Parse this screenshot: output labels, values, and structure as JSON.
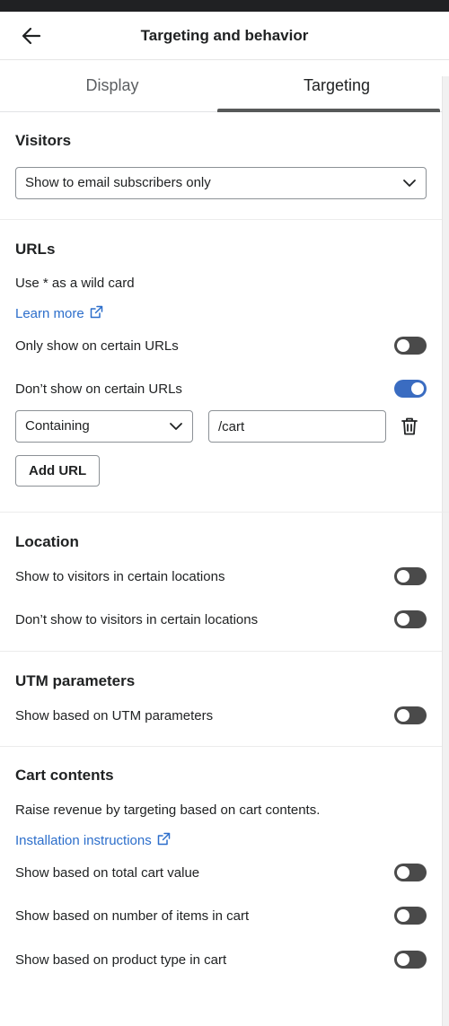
{
  "header": {
    "title": "Targeting and behavior"
  },
  "tabs": [
    {
      "label": "Display",
      "active": false
    },
    {
      "label": "Targeting",
      "active": true
    }
  ],
  "visitors": {
    "heading": "Visitors",
    "selected": "Show to email subscribers only"
  },
  "urls": {
    "heading": "URLs",
    "hint": "Use * as a wild card",
    "learn_more": "Learn more",
    "only_show": {
      "label": "Only show on certain URLs",
      "on": false
    },
    "dont_show": {
      "label": "Don’t show on certain URLs",
      "on": true
    },
    "rule": {
      "match": "Containing",
      "value": "/cart"
    },
    "add_label": "Add URL"
  },
  "location": {
    "heading": "Location",
    "show": {
      "label": "Show to visitors in certain locations",
      "on": false
    },
    "dont_show": {
      "label": "Don’t show to visitors in certain locations",
      "on": false
    }
  },
  "utm": {
    "heading": "UTM parameters",
    "show": {
      "label": "Show based on UTM parameters",
      "on": false
    }
  },
  "cart": {
    "heading": "Cart contents",
    "description": "Raise revenue by targeting based on cart contents.",
    "install_link": "Installation instructions",
    "total_value": {
      "label": "Show based on total cart value",
      "on": false
    },
    "num_items": {
      "label": "Show based on number of items in cart",
      "on": false
    },
    "product_type": {
      "label": "Show based on product type in cart",
      "on": false
    }
  },
  "colors": {
    "toggle_on": "#3a6cc1",
    "toggle_off": "#4a4a4a",
    "link": "#2c6ecb"
  },
  "icons": [
    "arrow-left-icon",
    "chevron-down-icon",
    "external-link-icon",
    "trash-icon"
  ]
}
